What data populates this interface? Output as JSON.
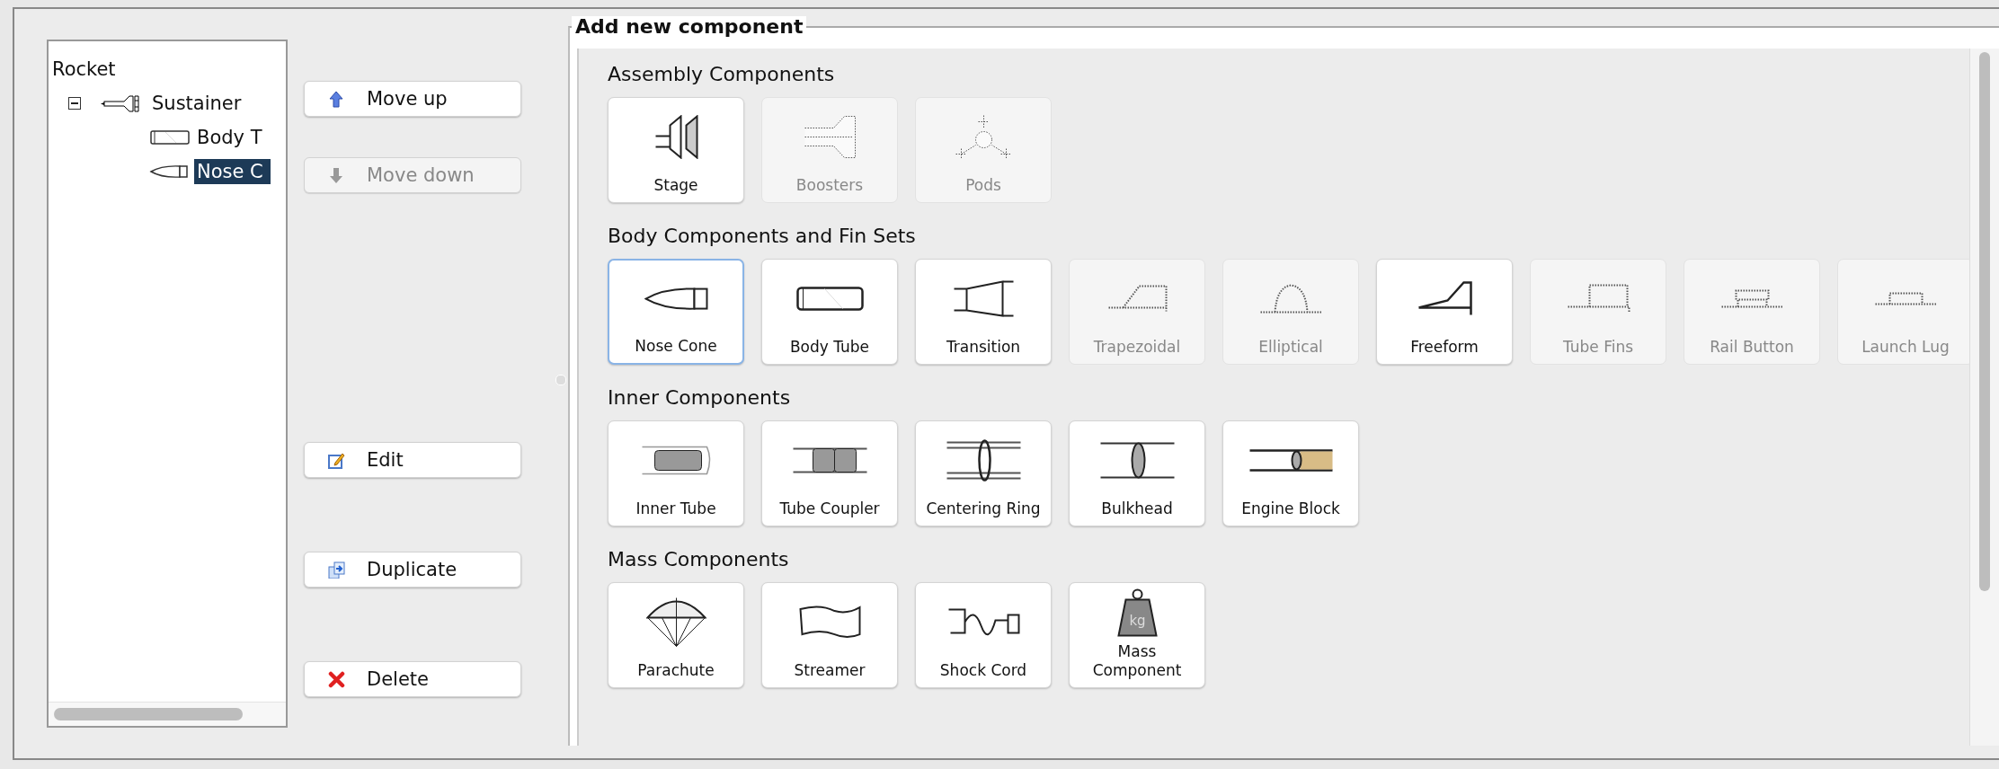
{
  "tree": {
    "root": {
      "label": "Rocket",
      "children": [
        {
          "label": "Sustainer",
          "expanded": true,
          "children": [
            {
              "label": "Body T",
              "selected": false
            },
            {
              "label": "Nose C",
              "selected": true
            }
          ]
        }
      ]
    }
  },
  "buttons": [
    {
      "label": "Move up",
      "disabled": false
    },
    {
      "label": "Move down",
      "disabled": true
    },
    {
      "label": "Edit",
      "disabled": false
    },
    {
      "label": "Duplicate",
      "disabled": false
    },
    {
      "label": "Delete",
      "disabled": false
    }
  ],
  "palette": {
    "title": "Add new component",
    "sections": [
      {
        "heading": "Assembly Components",
        "items": [
          {
            "label": "Stage",
            "disabled": false,
            "selected": false
          },
          {
            "label": "Boosters",
            "disabled": true,
            "selected": false
          },
          {
            "label": "Pods",
            "disabled": true,
            "selected": false
          }
        ]
      },
      {
        "heading": "Body Components and Fin Sets",
        "items": [
          {
            "label": "Nose Cone",
            "disabled": false,
            "selected": true
          },
          {
            "label": "Body Tube",
            "disabled": false,
            "selected": false
          },
          {
            "label": "Transition",
            "disabled": false,
            "selected": false
          },
          {
            "label": "Trapezoidal",
            "disabled": true,
            "selected": false
          },
          {
            "label": "Elliptical",
            "disabled": true,
            "selected": false
          },
          {
            "label": "Freeform",
            "disabled": false,
            "selected": false
          },
          {
            "label": "Tube Fins",
            "disabled": true,
            "selected": false
          },
          {
            "label": "Rail Button",
            "disabled": true,
            "selected": false
          },
          {
            "label": "Launch Lug",
            "disabled": true,
            "selected": false
          }
        ]
      },
      {
        "heading": "Inner Components",
        "items": [
          {
            "label": "Inner Tube",
            "disabled": false,
            "selected": false
          },
          {
            "label": "Tube Coupler",
            "disabled": false,
            "selected": false
          },
          {
            "label": "Centering Ring",
            "disabled": false,
            "selected": false
          },
          {
            "label": "Bulkhead",
            "disabled": false,
            "selected": false
          },
          {
            "label": "Engine Block",
            "disabled": false,
            "selected": false
          }
        ]
      },
      {
        "heading": "Mass Components",
        "items": [
          {
            "label": "Parachute",
            "disabled": false,
            "selected": false
          },
          {
            "label": "Streamer",
            "disabled": false,
            "selected": false
          },
          {
            "label": "Shock Cord",
            "disabled": false,
            "selected": false
          },
          {
            "label": "Mass Component",
            "disabled": false,
            "selected": false,
            "icon_text": "kg"
          }
        ]
      }
    ]
  }
}
